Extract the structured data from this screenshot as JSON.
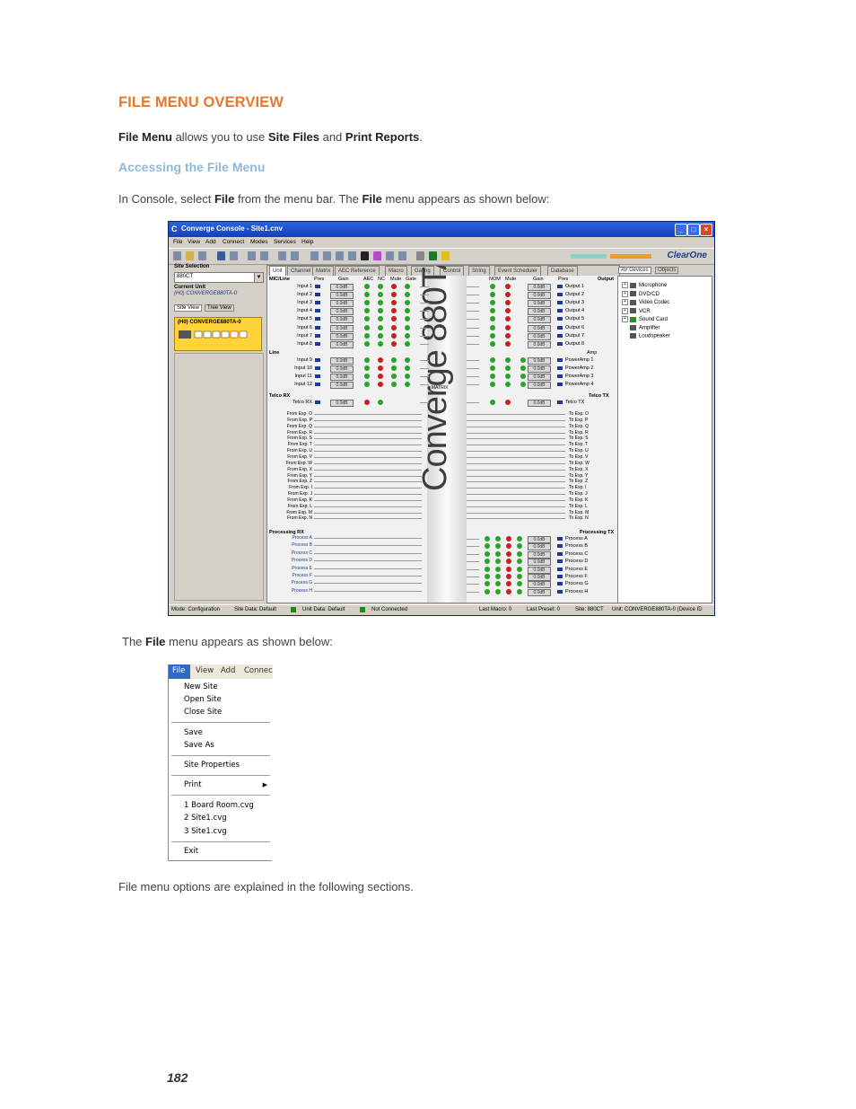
{
  "doc": {
    "heading": "FILE MENU OVERVIEW",
    "intro": {
      "t1": "File Menu",
      "t2": " allows you to use ",
      "t3": "Site Files",
      "t4": " and ",
      "t5": "Print Reports",
      "t6": "."
    },
    "subheading": "Accessing the File Menu",
    "para2": {
      "t1": "In Console, select ",
      "t2": "File",
      "t3": " from the menu bar. The ",
      "t4": "File",
      "t5": " menu appears as shown below:"
    },
    "para3": {
      "t1": "The ",
      "t2": "File",
      "t3": " menu appears as shown below:"
    },
    "para4": "File menu options are explained in the following sections.",
    "page_number": "182"
  },
  "console": {
    "title": "Converge Console - Site1.cnv",
    "menu": [
      "File",
      "View",
      "Add",
      "Connect",
      "Modes",
      "Services",
      "Help"
    ],
    "brand": "ClearOne",
    "site_selection_label": "Site Selection",
    "site_selection_value": "880CT",
    "current_unit_label": "Current Unit",
    "current_unit_value": "(H0) CONVERGE880TA-0",
    "left_tabs": [
      "Site View",
      "Tree View"
    ],
    "unit_label": "(H0) CONVERGE880TA-0",
    "tabs": [
      "Unit",
      "Channel",
      "Matrix",
      "AEC Reference",
      "Macro",
      "Gating",
      "Control",
      "String",
      "Event Scheduler",
      "Database"
    ],
    "right_tabs": [
      "AV Devices",
      "Objects"
    ],
    "av_devices": [
      "Microphone",
      "DVD/CD",
      "Video Codec",
      "VCR",
      "Sound Card",
      "Amplifier",
      "Loudspeaker"
    ],
    "section_mic": "MIC/Line",
    "section_line": "Line",
    "section_telco_rx": "Telco RX",
    "section_processing_rx": "Processing RX",
    "section_output": "Output",
    "section_telco_tx": "Telco TX",
    "section_processing_tx": "Processing TX",
    "col_headers_left": [
      "Pres",
      "Gain",
      "AEC",
      "NC",
      "Mute",
      "Gate"
    ],
    "col_headers_right": [
      "NOM",
      "Mute",
      "Gain",
      "Pres"
    ],
    "amp_label": "Amp",
    "matrix_label": "MATRIX",
    "gain_value": "0.0dB",
    "inputs": [
      "Input 1",
      "Input 2",
      "Input 3",
      "Input 4",
      "Input 5",
      "Input 6",
      "Input 7",
      "Input 8"
    ],
    "line_inputs": [
      "Input 9",
      "Input 10",
      "Input 11",
      "Input 12"
    ],
    "telco_rx": "Telco RX",
    "outputs": [
      "Output 1",
      "Output 2",
      "Output 3",
      "Output 4",
      "Output 5",
      "Output 6",
      "Output 7",
      "Output 8"
    ],
    "power_amps": [
      "PowerAmp 1",
      "PowerAmp 2",
      "PowerAmp 3",
      "PowerAmp 4"
    ],
    "telco_tx": "Telco TX",
    "exp_rx": [
      "From Exp. O",
      "From Exp. P",
      "From Exp. Q",
      "From Exp. R",
      "From Exp. S",
      "From Exp. T",
      "From Exp. U",
      "From Exp. V",
      "From Exp. W",
      "From Exp. X",
      "From Exp. Y",
      "From Exp. Z",
      "From Exp. I",
      "From Exp. J",
      "From Exp. K",
      "From Exp. L",
      "From Exp. M",
      "From Exp. N"
    ],
    "exp_tx": [
      "To Exp. O",
      "To Exp. P",
      "To Exp. Q",
      "To Exp. R",
      "To Exp. S",
      "To Exp. T",
      "To Exp. U",
      "To Exp. V",
      "To Exp. W",
      "To Exp. X",
      "To Exp. Y",
      "To Exp. Z",
      "To Exp. I",
      "To Exp. J",
      "To Exp. K",
      "To Exp. L",
      "To Exp. M",
      "To Exp. N"
    ],
    "process_rx": [
      "Process A",
      "Process B",
      "Process C",
      "Process D",
      "Process E",
      "Process F",
      "Process G",
      "Process H"
    ],
    "process_tx": [
      "Process A",
      "Process B",
      "Process C",
      "Process D",
      "Process E",
      "Process F",
      "Process G",
      "Process H"
    ],
    "brand_vertical": "Converge 880TA",
    "status": {
      "mode": "Mode: Configuration",
      "site_data": "Site Data: Default",
      "unit_data": "Unit Data: Default",
      "connection": "Not Connected",
      "last_macro": "Last Macro: 0",
      "last_preset": "Last Preset: 0",
      "site": "Site: 880CT",
      "unit": "Unit: CONVERGE880TA-0 (Device ID"
    }
  },
  "file_menu": {
    "bar": [
      "File",
      "View",
      "Add",
      "Connec"
    ],
    "items": {
      "new_site": "New Site",
      "open_site": "Open Site",
      "close_site": "Close Site",
      "save": "Save",
      "save_as": "Save As",
      "site_properties": "Site Properties",
      "print": "Print",
      "recent1": "1  Board Room.cvg",
      "recent2": "2  Site1.cvg",
      "recent3": "3  Site1.cvg",
      "exit": "Exit"
    }
  }
}
